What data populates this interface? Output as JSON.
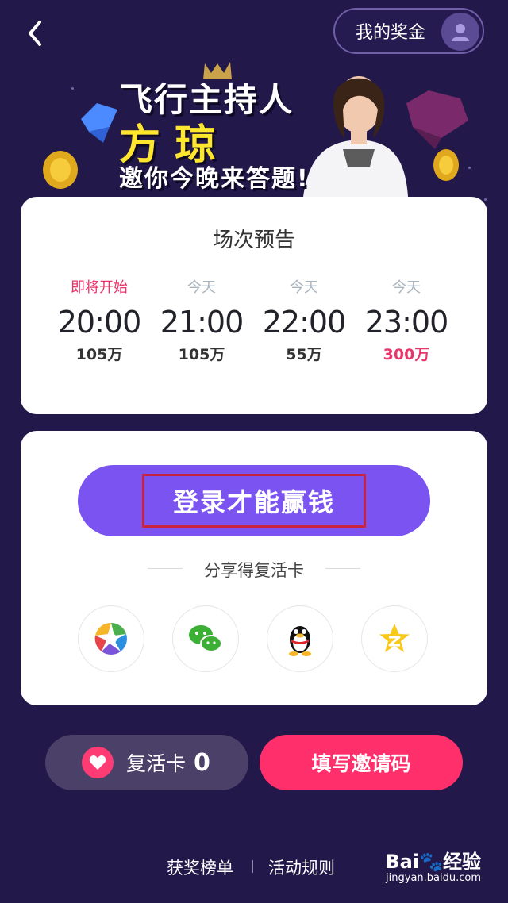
{
  "header": {
    "prize_label": "我的奖金"
  },
  "banner": {
    "line1": "飞行主持人",
    "line2": "方琼",
    "line3": "邀你今晚来答题!"
  },
  "schedule": {
    "title": "场次预告",
    "slots": [
      {
        "label": "即将开始",
        "time": "20:00",
        "amount": "105万"
      },
      {
        "label": "今天",
        "time": "21:00",
        "amount": "105万"
      },
      {
        "label": "今天",
        "time": "22:00",
        "amount": "55万"
      },
      {
        "label": "今天",
        "time": "23:00",
        "amount": "300万"
      }
    ]
  },
  "login": {
    "button_label": "登录才能赢钱",
    "share_title": "分享得复活卡",
    "share_icons": [
      "moments-icon",
      "wechat-icon",
      "qq-icon",
      "qzone-icon"
    ]
  },
  "bottom": {
    "revive_label": "复活卡",
    "revive_count": "0",
    "invite_label": "填写邀请码"
  },
  "footer": {
    "leaderboard": "获奖榜单",
    "rules": "活动规则"
  },
  "watermark": {
    "brand": "Bai",
    "brand2": "经验",
    "url": "jingyan.baidu.com"
  },
  "colors": {
    "background": "#23184a",
    "accent_purple": "#7a53f0",
    "accent_pink": "#ff2f6b",
    "highlight_red": "#e8356a"
  }
}
